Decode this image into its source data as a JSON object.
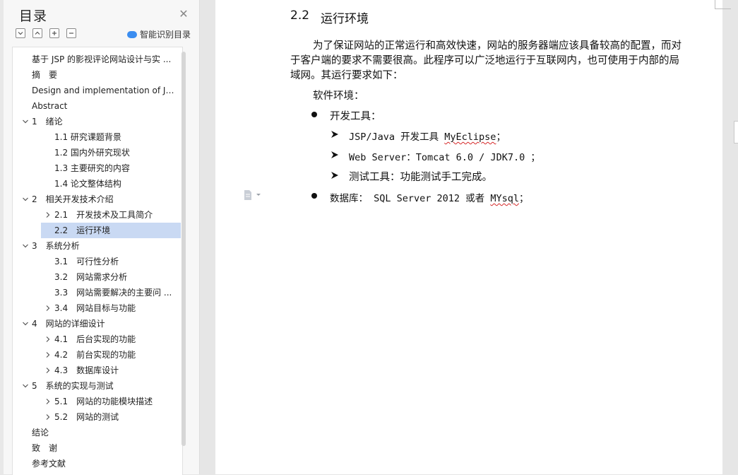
{
  "toc": {
    "title": "目录",
    "smart_label": "智能识别目录",
    "items": [
      {
        "label": "基于 JSP 的影视评论网站设计与实 ..."
      },
      {
        "label": "摘　要"
      },
      {
        "label": "Design and implementation of Ja ..."
      },
      {
        "label": "Abstract"
      },
      {
        "label": "1　绪论"
      },
      {
        "label": "1.1  研究课题背景"
      },
      {
        "label": "1.2  国内外研究现状"
      },
      {
        "label": "1.3 主要研究的内容"
      },
      {
        "label": "1.4  论文整体结构"
      },
      {
        "label": "2　相关开发技术介绍"
      },
      {
        "label": "2.1　开发技术及工具简介"
      },
      {
        "label": "2.2　运行环境"
      },
      {
        "label": "3　系统分析"
      },
      {
        "label": "3.1　可行性分析"
      },
      {
        "label": "3.2　网站需求分析"
      },
      {
        "label": "3.3　网站需要解决的主要问 ..."
      },
      {
        "label": "3.4　网站目标与功能"
      },
      {
        "label": "4　网站的详细设计"
      },
      {
        "label": "4.1　后台实现的功能"
      },
      {
        "label": "4.2　前台实现的功能"
      },
      {
        "label": "4.3　数据库设计"
      },
      {
        "label": "5　系统的实现与测试"
      },
      {
        "label": "5.1　网站的功能模块描述"
      },
      {
        "label": "5.2　网站的测试"
      },
      {
        "label": "结论"
      },
      {
        "label": "致　谢"
      },
      {
        "label": "参考文献"
      }
    ]
  },
  "document": {
    "heading_number": "2.2",
    "heading_text": "运行环境",
    "para_line1": "为了保证网站的正常运行和高效快速，网站的服务器端应该具备较高的配置，而对",
    "para_line2": "于客户端的要求不需要很高。此程序可以广泛地运行于互联网内，也可使用于内部的局",
    "para_line3": "域网。其运行要求如下：",
    "software_env": "软件环境：",
    "dev_tools": "开发工具：",
    "tool1_prefix": "JSP/Java 开发工具 ",
    "tool1_name": "MyEclipse",
    "tool1_suffix": "；",
    "tool2": "Web Server：Tomcat 6.0 / JDK7.0 ；",
    "tool3": "测试工具：功能测试手工完成。",
    "db_prefix": "数据库：  SQL Server 2012 或者 ",
    "db_name": "MYsql",
    "db_suffix": "；"
  },
  "colors": {
    "active_item_bg": "#c9d9f3",
    "spellcheck": "#d62828",
    "smart_icon": "#3b8df0"
  }
}
